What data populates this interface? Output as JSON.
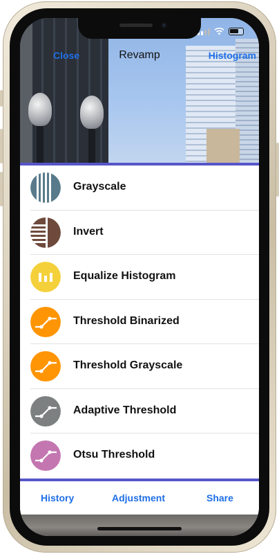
{
  "status": {
    "time": ""
  },
  "nav": {
    "close_label": "Close",
    "title": "Revamp",
    "histogram_label": "Histogram"
  },
  "filters": [
    {
      "label": "Grayscale",
      "icon": "grayscale-stripes-icon",
      "color": "#587a8a"
    },
    {
      "label": "Invert",
      "icon": "invert-stripes-icon",
      "color": "#6e4a3c"
    },
    {
      "label": "Equalize Histogram",
      "icon": "histogram-bars-icon",
      "color": "#f4d03a"
    },
    {
      "label": "Threshold Binarized",
      "icon": "threshold-curve-icon",
      "color": "#ff9505"
    },
    {
      "label": "Threshold Grayscale",
      "icon": "threshold-curve-icon",
      "color": "#ff9505"
    },
    {
      "label": "Adaptive Threshold",
      "icon": "threshold-curve-icon",
      "color": "#7d8080"
    },
    {
      "label": "Otsu Threshold",
      "icon": "threshold-curve-icon",
      "color": "#c476b0"
    }
  ],
  "tabs": {
    "history_label": "History",
    "adjustment_label": "Adjustment",
    "share_label": "Share"
  },
  "colors": {
    "accent": "#1e6fe6",
    "divider": "#5756c8"
  }
}
